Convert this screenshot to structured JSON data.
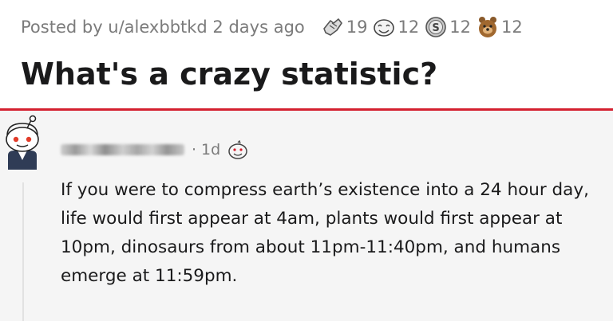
{
  "post": {
    "meta": "Posted by u/alexbbtkd 2 days ago",
    "title": "What's a crazy statistic?",
    "awards": [
      {
        "icon": "wholesome-hands-award-icon",
        "count": "19"
      },
      {
        "icon": "silly-face-award-icon",
        "count": "12"
      },
      {
        "icon": "silver-award-icon",
        "count": "12"
      },
      {
        "icon": "bear-award-icon",
        "count": "12"
      }
    ]
  },
  "comment": {
    "age": "1d",
    "award_icon": "face-award-icon",
    "body": "If you were to compress earth’s existence into a 24 hour day, life would first appear at 4am, plants would first appear at 10pm, dinosaurs from about 11pm-11:40pm, and humans emerge at 11:59pm."
  },
  "colors": {
    "accent_red": "#d4202f",
    "meta_gray": "#7b7b7b",
    "text_dark": "#1a1a1b",
    "comment_bg": "#f5f5f5"
  }
}
